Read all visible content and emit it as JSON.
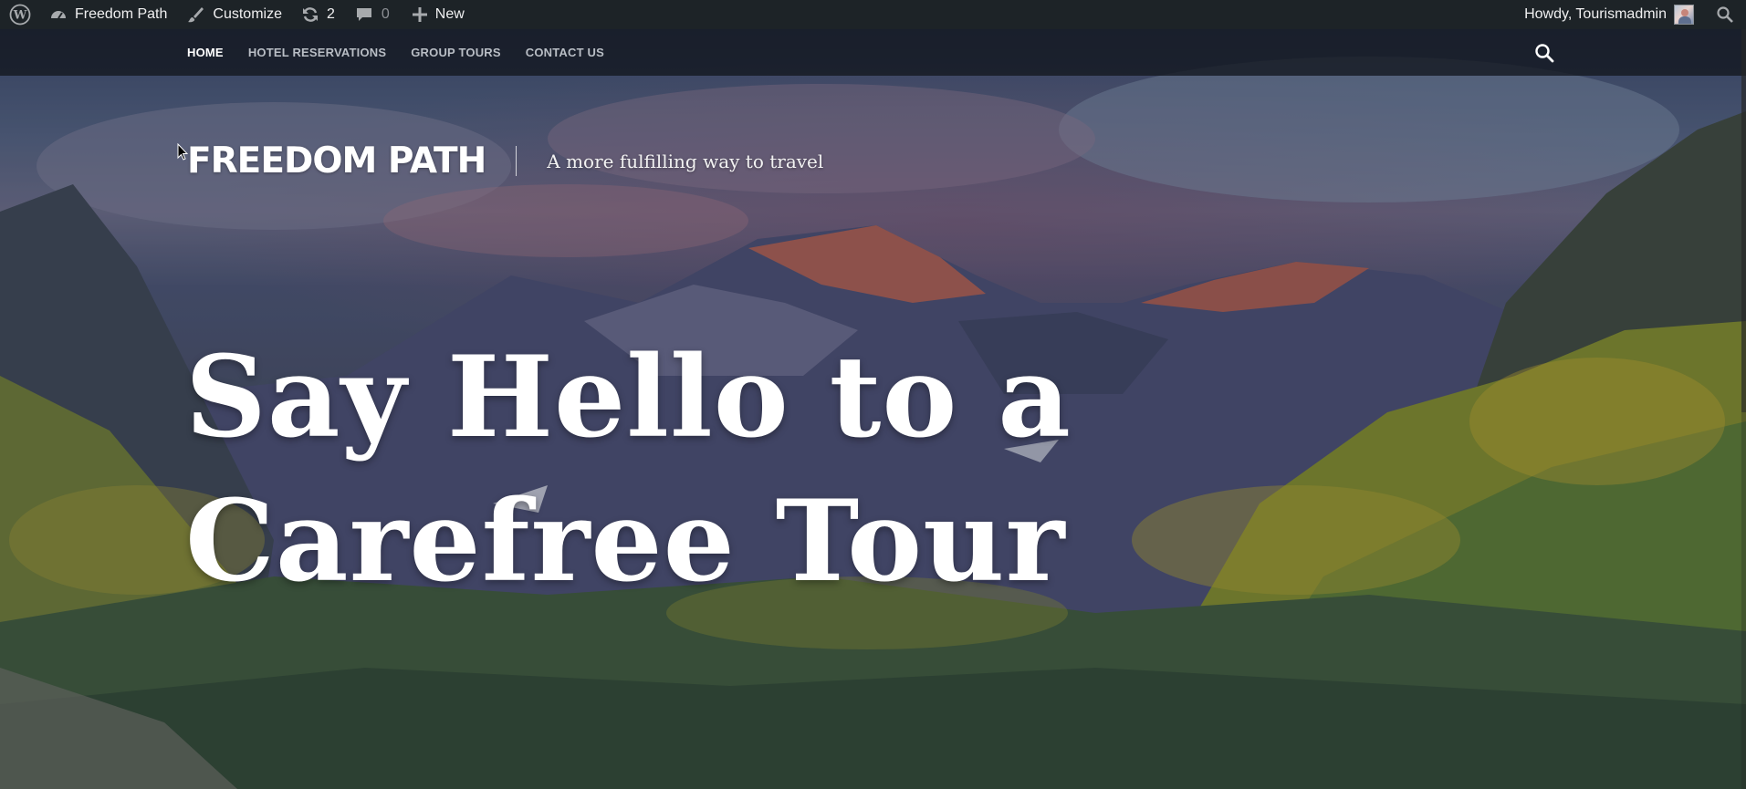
{
  "admin_bar": {
    "wp_logo_icon": "wordpress-icon",
    "site_name": "Freedom Path",
    "customize_label": "Customize",
    "updates_count": "2",
    "comments_count": "0",
    "new_label": "New",
    "howdy_text": "Howdy, Tourismadmin"
  },
  "site_nav": {
    "items": [
      {
        "label": "HOME",
        "active": true
      },
      {
        "label": "HOTEL RESERVATIONS",
        "active": false
      },
      {
        "label": "GROUP TOURS",
        "active": false
      },
      {
        "label": "CONTACT US",
        "active": false
      }
    ]
  },
  "branding": {
    "site_title": "FREEDOM PATH",
    "tagline": "A more fulfilling way to travel"
  },
  "hero": {
    "headline": "Say Hello to a Carefree Tour"
  },
  "colors": {
    "admin_bar_bg": "#1d2327",
    "nav_active": "#ffffff",
    "nav_inactive": "#b9bec5"
  }
}
